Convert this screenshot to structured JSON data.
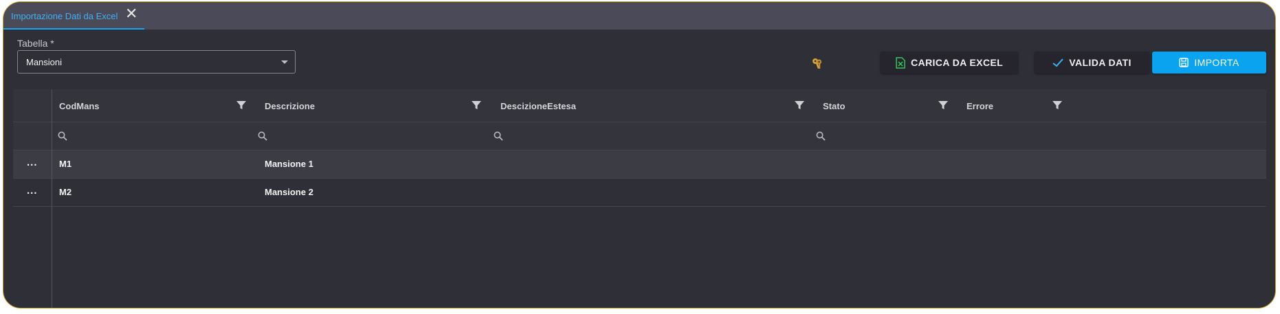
{
  "tab": {
    "label": "Importazione Dati da Excel",
    "close": "✕"
  },
  "form": {
    "table_label": "Tabella *",
    "table_value": "Mansioni"
  },
  "toolbar": {
    "excel_label": "CARICA DA EXCEL",
    "valida_label": "VALIDA DATI",
    "importa_label": "IMPORTA"
  },
  "colors": {
    "accent": "#0aa3f0",
    "excel_green": "#34c759",
    "key_gold": "#d6a83a",
    "frame_border": "#c9a227"
  },
  "grid": {
    "columns": [
      "CodMans",
      "Descrizione",
      "DescizioneEstesa",
      "Stato",
      "Errore"
    ],
    "rows": [
      {
        "actions": "...",
        "CodMans": "M1",
        "Descrizione": "Mansione 1",
        "DescizioneEstesa": "",
        "Stato": "",
        "Errore": ""
      },
      {
        "actions": "...",
        "CodMans": "M2",
        "Descrizione": "Mansione 2",
        "DescizioneEstesa": "",
        "Stato": "",
        "Errore": ""
      }
    ]
  }
}
